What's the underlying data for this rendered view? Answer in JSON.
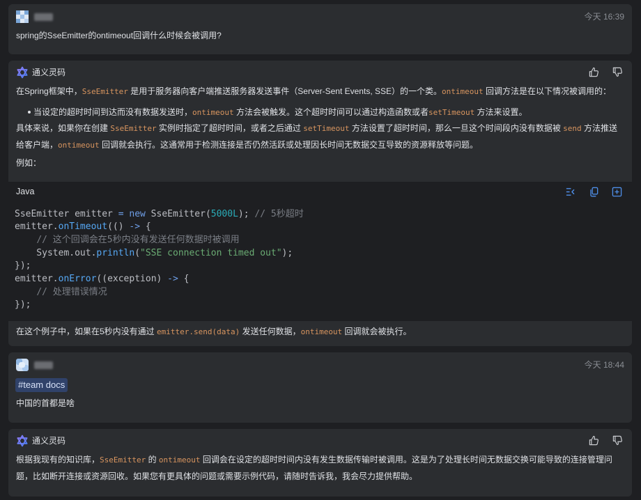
{
  "theme": {
    "page_background": "#1e1f22",
    "card_background": "#2b2d30",
    "text_color": "#dfe1e5",
    "muted_color": "#8a8d93",
    "inline_code_color": "#d8955f",
    "action_icon_color": "#4e8ee8",
    "feedback_icon_color": "#c9cbcf",
    "tag_background": "#30426a",
    "tag_text_color": "#d7e1f7",
    "code_background": "#1e1f22",
    "syntax_colors": {
      "plain": "#bcbec4",
      "keyword": "#6f9fe8",
      "number": "#2aacb8",
      "comment": "#7a7e85",
      "method": "#56a8f5",
      "string": "#6aab73"
    }
  },
  "conversation": {
    "user_1": {
      "avatar_icon": "user-avatar-icon",
      "timestamp": "今天 16:39",
      "text": "spring的SseEmitter的ontimeout回调什么时候会被调用?"
    },
    "assistant_1": {
      "sender": "通义灵码",
      "logo_icon": "tongyi-lingma-logo-icon",
      "feedback_icons": [
        "thumbs-up-icon",
        "thumbs-down-icon"
      ],
      "intro": [
        {
          "text": "在Spring框架中，",
          "code": false
        },
        {
          "text": "SseEmitter",
          "code": true
        },
        {
          "text": " 是用于服务器向客户端推送服务器发送事件（Server-Sent Events, SSE）的一个类。",
          "code": false
        },
        {
          "text": "ontimeout",
          "code": true
        },
        {
          "text": " 回调方法是在以下情况被调用的：",
          "code": false
        }
      ],
      "bullets": [
        [
          {
            "text": "当设定的超时时间到达而没有数据发送时，",
            "code": false
          },
          {
            "text": "ontimeout",
            "code": true
          },
          {
            "text": " 方法会被触发。这个超时时间可以通过构造函数或者",
            "code": false
          },
          {
            "text": "setTimeout",
            "code": true
          },
          {
            "text": " 方法来设置。",
            "code": false
          }
        ]
      ],
      "detail": [
        {
          "text": "具体来说，如果你在创建 ",
          "code": false
        },
        {
          "text": "SseEmitter",
          "code": true
        },
        {
          "text": " 实例时指定了超时时间，或者之后通过 ",
          "code": false
        },
        {
          "text": "setTimeout",
          "code": true
        },
        {
          "text": " 方法设置了超时时间，那么一旦这个时间段内没有数据被 ",
          "code": false
        },
        {
          "text": "send",
          "code": true
        },
        {
          "text": " 方法推送给客户端，",
          "code": false
        },
        {
          "text": "ontimeout",
          "code": true
        },
        {
          "text": " 回调就会执行。这通常用于检测连接是否仍然活跃或处理因长时间无数据交互导致的资源释放等问题。",
          "code": false
        }
      ],
      "example_label": "例如：",
      "code_block": {
        "language": "Java",
        "action_icons": [
          "insert-at-cursor-icon",
          "copy-icon",
          "new-file-icon"
        ],
        "lines": [
          [
            {
              "text": "SseEmitter emitter ",
              "kind": "plain"
            },
            {
              "text": "= new",
              "kind": "keyword"
            },
            {
              "text": " SseEmitter(",
              "kind": "plain"
            },
            {
              "text": "5000L",
              "kind": "number"
            },
            {
              "text": "); ",
              "kind": "plain"
            },
            {
              "text": "// 5秒超时",
              "kind": "comment"
            }
          ],
          [
            {
              "text": "emitter.",
              "kind": "plain"
            },
            {
              "text": "onTimeout",
              "kind": "method"
            },
            {
              "text": "(() ",
              "kind": "plain"
            },
            {
              "text": "->",
              "kind": "keyword"
            },
            {
              "text": " {",
              "kind": "plain"
            }
          ],
          [
            {
              "text": "    ",
              "kind": "plain"
            },
            {
              "text": "// 这个回调会在5秒内没有发送任何数据时被调用",
              "kind": "comment"
            }
          ],
          [
            {
              "text": "    System.out.",
              "kind": "plain"
            },
            {
              "text": "println",
              "kind": "method"
            },
            {
              "text": "(",
              "kind": "plain"
            },
            {
              "text": "\"SSE connection timed out\"",
              "kind": "string"
            },
            {
              "text": ");",
              "kind": "plain"
            }
          ],
          [
            {
              "text": "});",
              "kind": "plain"
            }
          ],
          [
            {
              "text": "emitter.",
              "kind": "plain"
            },
            {
              "text": "onError",
              "kind": "method"
            },
            {
              "text": "((exception) ",
              "kind": "plain"
            },
            {
              "text": "->",
              "kind": "keyword"
            },
            {
              "text": " {",
              "kind": "plain"
            }
          ],
          [
            {
              "text": "    ",
              "kind": "plain"
            },
            {
              "text": "// 处理错误情况",
              "kind": "comment"
            }
          ],
          [
            {
              "text": "});",
              "kind": "plain"
            }
          ]
        ]
      },
      "conclusion": [
        {
          "text": "在这个例子中，如果在5秒内没有通过 ",
          "code": false
        },
        {
          "text": "emitter.send(data)",
          "code": true
        },
        {
          "text": " 发送任何数据，",
          "code": false
        },
        {
          "text": "ontimeout",
          "code": true
        },
        {
          "text": " 回调就会被执行。",
          "code": false
        }
      ]
    },
    "user_2": {
      "avatar_icon": "user-avatar-icon",
      "timestamp": "今天 18:44",
      "tag": "#team docs",
      "text": "中国的首都是啥"
    },
    "assistant_2": {
      "sender": "通义灵码",
      "logo_icon": "tongyi-lingma-logo-icon",
      "feedback_icons": [
        "thumbs-up-icon",
        "thumbs-down-icon"
      ],
      "body": [
        {
          "text": "根据我现有的知识库，",
          "code": false
        },
        {
          "text": "SseEmitter",
          "code": true
        },
        {
          "text": " 的 ",
          "code": false
        },
        {
          "text": "ontimeout",
          "code": true
        },
        {
          "text": " 回调会在设定的超时时间内没有发生数据传输时被调用。这是为了处理长时间无数据交换可能导致的连接管理问题，比如断开连接或资源回收。如果您有更具体的问题或需要示例代码，请随时告诉我，我会尽力提供帮助。",
          "code": false
        }
      ]
    }
  }
}
